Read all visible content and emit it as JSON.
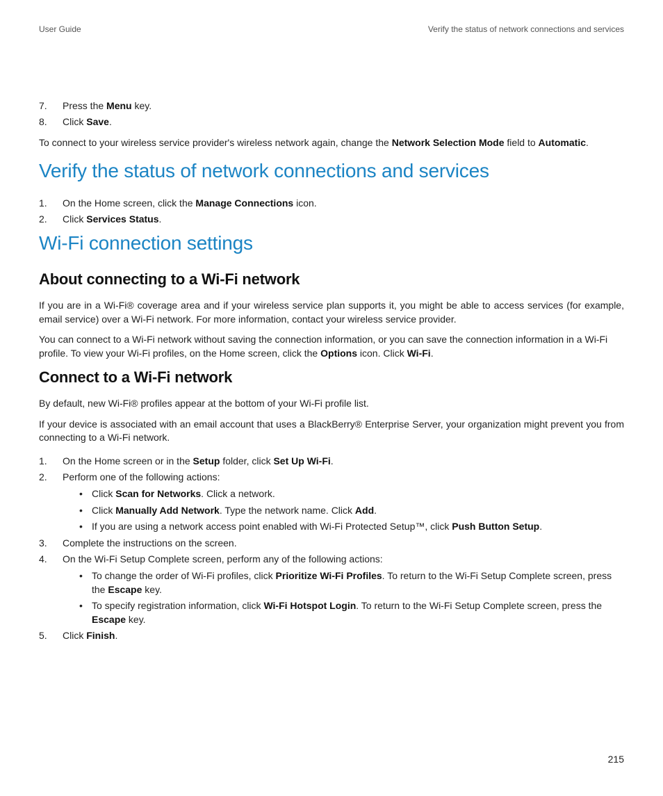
{
  "header": {
    "left": "User Guide",
    "right": "Verify the status of network connections and services"
  },
  "top_steps": {
    "s7_a": "Press the ",
    "s7_b": "Menu",
    "s7_c": " key.",
    "s8_a": "Click ",
    "s8_b": "Save",
    "s8_c": "."
  },
  "top_para": {
    "a": "To connect to your wireless service provider's wireless network again, change the ",
    "b": "Network Selection Mode",
    "c": " field to ",
    "d": "Automatic",
    "e": "."
  },
  "h_verify": "Verify the status of network connections and services",
  "verify_steps": {
    "s1_a": "On the Home screen, click the ",
    "s1_b": "Manage Connections",
    "s1_c": " icon.",
    "s2_a": "Click ",
    "s2_b": "Services Status",
    "s2_c": "."
  },
  "h_wifi": "Wi-Fi connection settings",
  "h_about": "About connecting to a Wi-Fi network",
  "about_p1": "If you are in a Wi-Fi® coverage area and if your wireless service plan supports it, you might be able to access services (for example, email service) over a Wi-Fi network. For more information, contact your wireless service provider.",
  "about_p2": {
    "a": "You can connect to a Wi-Fi network without saving the connection information, or you can save the connection information in a Wi-Fi profile. To view your Wi-Fi profiles, on the Home screen, click the ",
    "b": "Options",
    "c": " icon. Click ",
    "d": "Wi-Fi",
    "e": "."
  },
  "h_connect": "Connect to a Wi-Fi network",
  "connect_p1": "By default, new Wi-Fi® profiles appear at the bottom of your Wi-Fi profile list.",
  "connect_p2": "If your device is associated with an email account that uses a BlackBerry® Enterprise Server, your organization might prevent you from connecting to a Wi-Fi network.",
  "connect_steps": {
    "s1_a": "On the Home screen or in the ",
    "s1_b": "Setup",
    "s1_c": " folder, click ",
    "s1_d": "Set Up Wi-Fi",
    "s1_e": ".",
    "s2": "Perform one of the following actions:",
    "s2_sub1_a": "Click ",
    "s2_sub1_b": "Scan for Networks",
    "s2_sub1_c": ". Click a network.",
    "s2_sub2_a": "Click ",
    "s2_sub2_b": "Manually Add Network",
    "s2_sub2_c": ". Type the network name. Click ",
    "s2_sub2_d": "Add",
    "s2_sub2_e": ".",
    "s2_sub3_a": "If you are using a network access point enabled with Wi-Fi Protected Setup™, click ",
    "s2_sub3_b": "Push Button Setup",
    "s2_sub3_c": ".",
    "s3": "Complete the instructions on the screen.",
    "s4": "On the Wi-Fi Setup Complete screen, perform any of the following actions:",
    "s4_sub1_a": "To change the order of Wi-Fi profiles, click ",
    "s4_sub1_b": "Prioritize Wi-Fi Profiles",
    "s4_sub1_c": ". To return to the Wi-Fi Setup Complete screen, press the ",
    "s4_sub1_d": "Escape",
    "s4_sub1_e": " key.",
    "s4_sub2_a": "To specify registration information, click ",
    "s4_sub2_b": "Wi-Fi Hotspot Login",
    "s4_sub2_c": ". To return to the Wi-Fi Setup Complete screen, press the ",
    "s4_sub2_d": "Escape",
    "s4_sub2_e": " key.",
    "s5_a": "Click ",
    "s5_b": "Finish",
    "s5_c": "."
  },
  "page_number": "215"
}
